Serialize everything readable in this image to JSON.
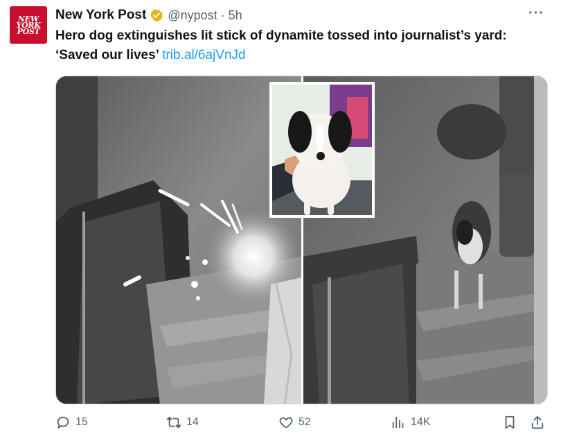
{
  "tweet": {
    "author_name": "New York Post",
    "handle": "@nypost",
    "separator": "·",
    "time": "5h",
    "avatar_line1": "NEW",
    "avatar_line2": "YORK",
    "avatar_line3": "POST",
    "text_line1": "Hero dog extinguishes lit stick of dynamite tossed into journalist’s yard:",
    "text_line2": "‘Saved our lives’",
    "link": "trib.al/6ajVnJd",
    "more_label": "···"
  },
  "actions": {
    "replies": "15",
    "reposts": "14",
    "likes": "52",
    "views": "14K"
  },
  "colors": {
    "brand_red": "#c8102e",
    "link_blue": "#1d9bf0",
    "verified_gold": "#e2b719",
    "muted": "#536471"
  }
}
